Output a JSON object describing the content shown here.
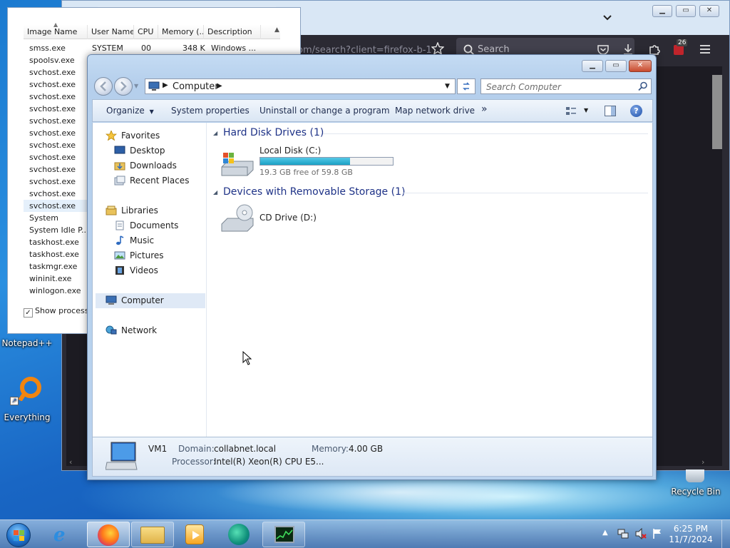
{
  "desktop": {
    "icons": [
      {
        "label": "Notepad++"
      },
      {
        "label": "Everything"
      },
      {
        "label": "Recycle Bin"
      }
    ]
  },
  "firefox": {
    "url_fragment": "om/search?client=firefox-b-1",
    "search_placeholder": "Search",
    "notification_badge": "26"
  },
  "task_manager": {
    "columns": [
      "Image Name",
      "User Name",
      "CPU",
      "Memory (...",
      "Description"
    ],
    "first_row": {
      "image": "smss.exe",
      "user": "SYSTEM",
      "cpu": "00",
      "memory": "348 K",
      "description": "Windows ..."
    },
    "processes": [
      "spoolsv.exe",
      "svchost.exe",
      "svchost.exe",
      "svchost.exe",
      "svchost.exe",
      "svchost.exe",
      "svchost.exe",
      "svchost.exe",
      "svchost.exe",
      "svchost.exe",
      "svchost.exe",
      "svchost.exe",
      "svchost.exe",
      "System",
      "System Idle P...",
      "taskhost.exe",
      "taskhost.exe",
      "taskmgr.exe",
      "wininit.exe",
      "winlogon.exe"
    ],
    "selected_index": 12,
    "show_processes_label": "Show processes"
  },
  "explorer": {
    "address": "Computer",
    "search_placeholder": "Search Computer",
    "commands": {
      "organize": "Organize",
      "system_properties": "System properties",
      "uninstall": "Uninstall or change a program",
      "map_drive": "Map network drive",
      "more": "»"
    },
    "nav": {
      "favorites": "Favorites",
      "desktop": "Desktop",
      "downloads": "Downloads",
      "recent": "Recent Places",
      "libraries": "Libraries",
      "documents": "Documents",
      "music": "Music",
      "pictures": "Pictures",
      "videos": "Videos",
      "computer": "Computer",
      "network": "Network"
    },
    "groups": {
      "hdd": "Hard Disk Drives (1)",
      "removable": "Devices with Removable Storage (1)"
    },
    "drives": {
      "local_name": "Local Disk (C:)",
      "local_free": "19.3 GB free of 59.8 GB",
      "local_used_fraction": 0.677,
      "cd_name": "CD Drive (D:)"
    },
    "details": {
      "name": "VM1",
      "domain_label": "Domain:",
      "domain_value": "collabnet.local",
      "memory_label": "Memory:",
      "memory_value": "4.00 GB",
      "processor_label": "Processor:",
      "processor_value": "Intel(R) Xeon(R) CPU E5..."
    }
  },
  "taskbar": {
    "time": "6:25 PM",
    "date": "11/7/2024"
  },
  "colors": {
    "accent_progress": "#1aa0c4",
    "group_heading": "#1e3287"
  }
}
